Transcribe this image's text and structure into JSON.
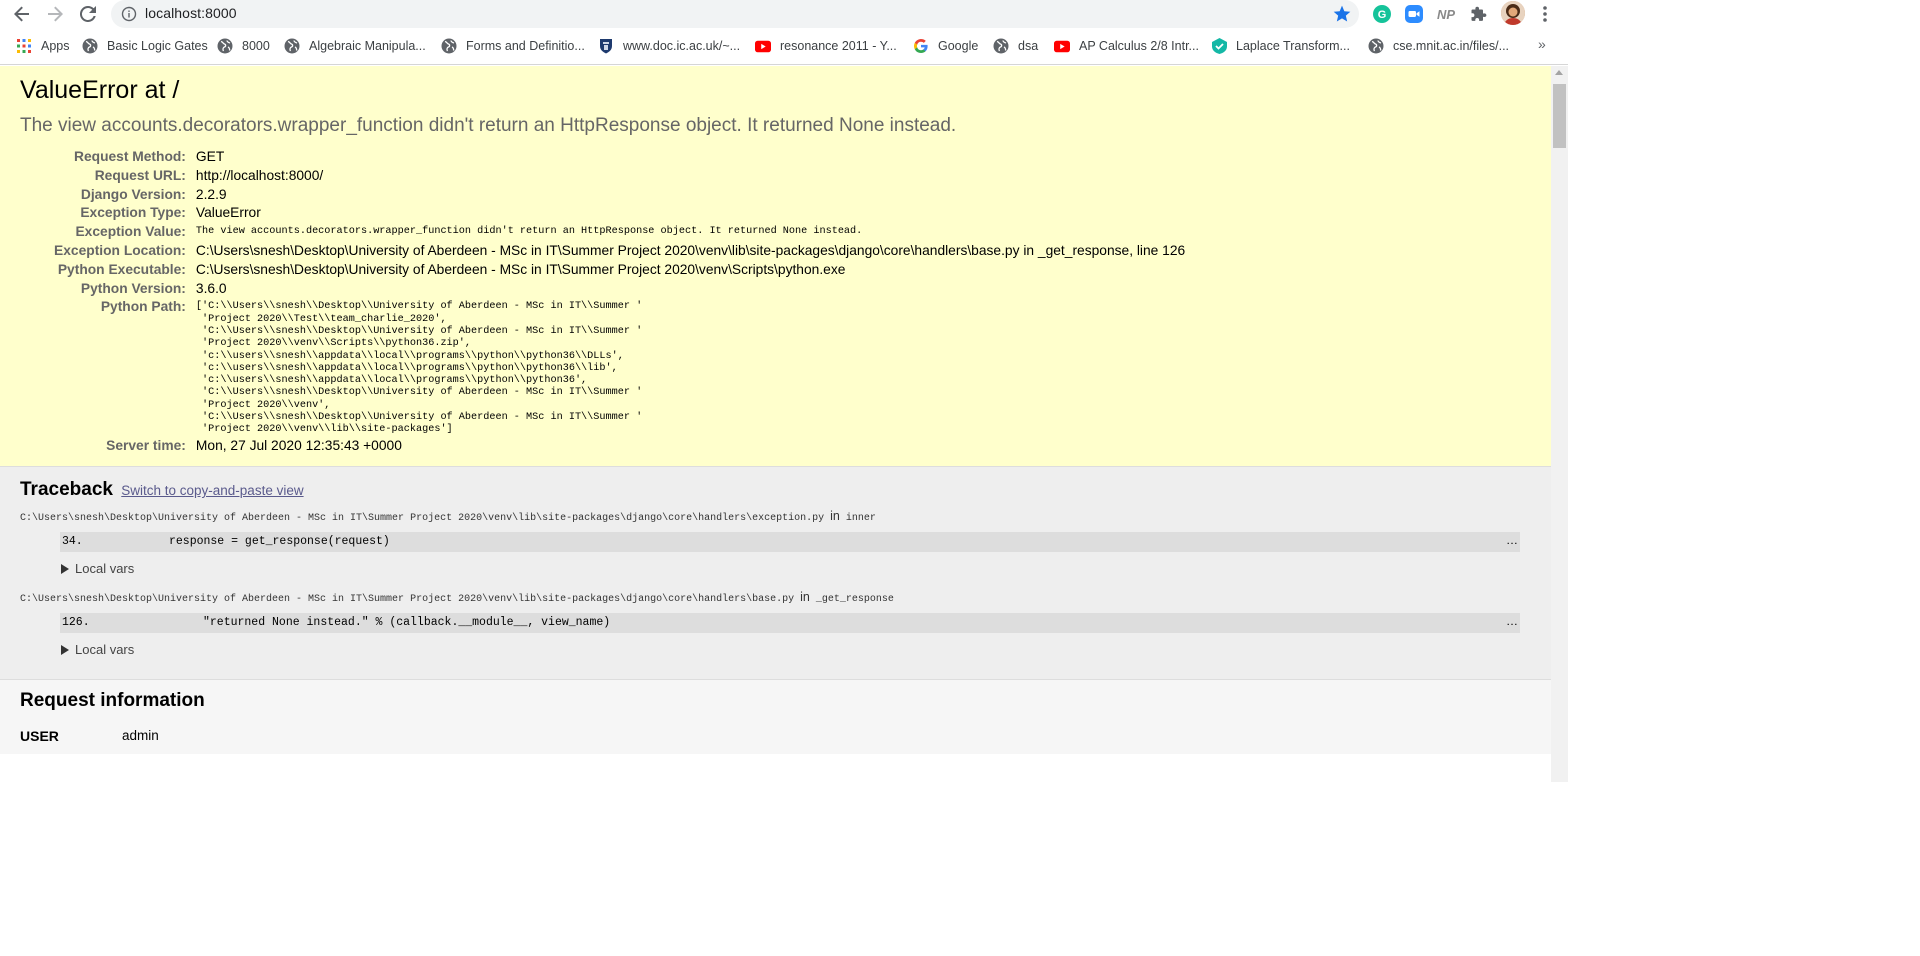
{
  "browser": {
    "url": "localhost:8000",
    "profile_initials": "NP",
    "bookmarks": [
      {
        "label": "Apps",
        "icon": "apps-grid-icon"
      },
      {
        "label": "Basic Logic Gates",
        "icon": "globe-icon"
      },
      {
        "label": "8000",
        "icon": "globe-icon"
      },
      {
        "label": "Algebraic Manipula...",
        "icon": "globe-icon"
      },
      {
        "label": "Forms and Definitio...",
        "icon": "globe-icon"
      },
      {
        "label": "www.doc.ic.ac.uk/~...",
        "icon": "imperial-icon"
      },
      {
        "label": "resonance 2011 - Y...",
        "icon": "youtube-icon"
      },
      {
        "label": "Google",
        "icon": "google-icon"
      },
      {
        "label": "dsa",
        "icon": "globe-icon"
      },
      {
        "label": "AP Calculus 2/8 Intr...",
        "icon": "youtube-icon"
      },
      {
        "label": "Laplace Transform...",
        "icon": "shield-check-icon"
      },
      {
        "label": "cse.mnit.ac.in/files/...",
        "icon": "globe-icon"
      }
    ],
    "overflow": "»",
    "colors": {
      "accent": "#1a73e8",
      "youtube": "#ff0000",
      "summary_bg": "#ffffcc",
      "traceback_bg": "#eeeeee"
    }
  },
  "summary": {
    "title": "ValueError at /",
    "message": "The view accounts.decorators.wrapper_function didn't return an HttpResponse object. It returned None instead.",
    "meta": [
      {
        "key": "Request Method:",
        "value": "GET"
      },
      {
        "key": "Request URL:",
        "value": "http://localhost:8000/"
      },
      {
        "key": "Django Version:",
        "value": "2.2.9"
      },
      {
        "key": "Exception Type:",
        "value": "ValueError"
      },
      {
        "key": "Exception Value:",
        "value": "The view accounts.decorators.wrapper_function didn't return an HttpResponse object. It returned None instead."
      },
      {
        "key": "Exception Location:",
        "value": "C:\\Users\\snesh\\Desktop\\University of Aberdeen - MSc in IT\\Summer Project 2020\\venv\\lib\\site-packages\\django\\core\\handlers\\base.py in _get_response, line 126"
      },
      {
        "key": "Python Executable:",
        "value": "C:\\Users\\snesh\\Desktop\\University of Aberdeen - MSc in IT\\Summer Project 2020\\venv\\Scripts\\python.exe"
      },
      {
        "key": "Python Version:",
        "value": "3.6.0"
      },
      {
        "key": "Python Path:",
        "value": "['C:\\\\Users\\\\snesh\\\\Desktop\\\\University of Aberdeen - MSc in IT\\\\Summer '\n 'Project 2020\\\\Test\\\\team_charlie_2020',\n 'C:\\\\Users\\\\snesh\\\\Desktop\\\\University of Aberdeen - MSc in IT\\\\Summer '\n 'Project 2020\\\\venv\\\\Scripts\\\\python36.zip',\n 'c:\\\\users\\\\snesh\\\\appdata\\\\local\\\\programs\\\\python\\\\python36\\\\DLLs',\n 'c:\\\\users\\\\snesh\\\\appdata\\\\local\\\\programs\\\\python\\\\python36\\\\lib',\n 'c:\\\\users\\\\snesh\\\\appdata\\\\local\\\\programs\\\\python\\\\python36',\n 'C:\\\\Users\\\\snesh\\\\Desktop\\\\University of Aberdeen - MSc in IT\\\\Summer '\n 'Project 2020\\\\venv',\n 'C:\\\\Users\\\\snesh\\\\Desktop\\\\University of Aberdeen - MSc in IT\\\\Summer '\n 'Project 2020\\\\venv\\\\lib\\\\site-packages']"
      },
      {
        "key": "Server time:",
        "value": "Mon, 27 Jul 2020 12:35:43 +0000"
      }
    ]
  },
  "traceback": {
    "title": "Traceback",
    "switch_link": "Switch to copy-and-paste view",
    "frames": [
      {
        "file": "C:\\Users\\snesh\\Desktop\\University of Aberdeen - MSc in IT\\Summer Project 2020\\venv\\lib\\site-packages\\django\\core\\handlers\\exception.py",
        "in_word": "in",
        "function": "inner",
        "line_no": "34.",
        "code": "response = get_response(request)",
        "ellipsis": "…",
        "localvars": "Local vars"
      },
      {
        "file": "C:\\Users\\snesh\\Desktop\\University of Aberdeen - MSc in IT\\Summer Project 2020\\venv\\lib\\site-packages\\django\\core\\handlers\\base.py",
        "in_word": "in",
        "function": "_get_response",
        "line_no": "126.",
        "code": "\"returned None instead.\" % (callback.__module__, view_name)",
        "ellipsis": "…",
        "localvars": "Local vars"
      }
    ]
  },
  "request_info": {
    "title": "Request information",
    "user_key": "USER",
    "user_value": "admin"
  }
}
